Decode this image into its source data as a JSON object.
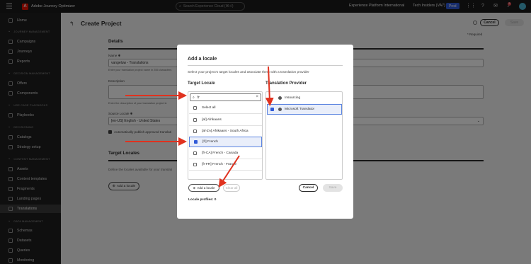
{
  "topbar": {
    "app_name": "Adobe Journey Optimizer",
    "search_placeholder": "Search Experience Cloud (⌘+/)",
    "org_name": "Experience Platform International",
    "sandbox_name": "Tech Insiders (VA7)",
    "env_badge": "Prod",
    "notification_count": "5"
  },
  "sidebar": {
    "home": "Home",
    "sections": [
      {
        "title": "JOURNEY MANAGEMENT",
        "items": [
          "Campaigns",
          "Journeys",
          "Reports"
        ]
      },
      {
        "title": "DECISION MANAGEMENT",
        "items": [
          "Offers",
          "Components"
        ]
      },
      {
        "title": "USE CASE PLAYBOOKS",
        "items": [
          "Playbooks"
        ]
      },
      {
        "title": "DECISIONING",
        "items": [
          "Catalogs",
          "Strategy setup"
        ]
      },
      {
        "title": "CONTENT MANAGEMENT",
        "items": [
          "Assets",
          "Content templates",
          "Fragments",
          "Landing pages",
          "Translations"
        ]
      },
      {
        "title": "DATA MANAGEMENT",
        "items": [
          "Schemas",
          "Datasets",
          "Queries",
          "Monitoring"
        ]
      }
    ],
    "active": "Translations"
  },
  "page": {
    "title": "Create Project",
    "cancel": "Cancel",
    "save": "Save",
    "required_note": "* Required",
    "details_heading": "Details",
    "name_label": "Name ✱",
    "name_value": "vangeluw - Translations",
    "name_help": "Enter your translation project name in 255 characters",
    "description_label": "Description",
    "description_help": "Enter the description of your translation project in",
    "source_label": "Source Locale ✱",
    "source_value": "[en-US] English - United States",
    "auto_publish_label": "Automatically publish approved translati",
    "target_heading": "Target Locales",
    "target_help": "Define the locales available for your translati",
    "add_locale": "Add a locale"
  },
  "modal": {
    "title": "Add a locale",
    "description": "Select your project's target locales and associate them with a translation provider",
    "target_locale_heading": "Target Locale",
    "provider_heading": "Translation Provider",
    "search_value": "fr",
    "select_all": "Select all",
    "locales": [
      {
        "label": "[af] Afrikaans",
        "checked": false
      },
      {
        "label": "[af-ZA] Afrikaans - South Africa",
        "checked": false
      },
      {
        "label": "[fr] French",
        "checked": true
      },
      {
        "label": "[fr-CA] French - Canada",
        "checked": false
      },
      {
        "label": "[fr-FR] French - France",
        "checked": false
      }
    ],
    "providers": [
      {
        "label": "Insourcing",
        "checked": false
      },
      {
        "label": "Microsoft Translator",
        "checked": true
      }
    ],
    "add_locale": "Add a locale",
    "clear_all": "Clear all",
    "cancel": "Cancel",
    "save": "Save",
    "locale_profiles": "Locale profiles: 0"
  },
  "colors": {
    "accent": "#2f5ad8",
    "annotation_arrow": "#e0321f",
    "brand": "#eb1000"
  }
}
